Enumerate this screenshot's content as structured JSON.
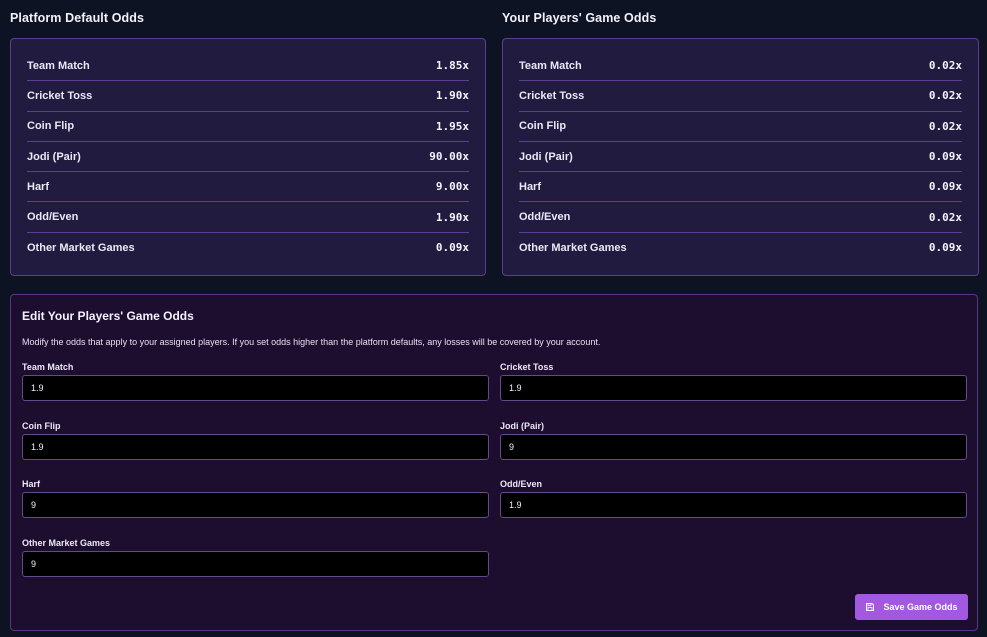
{
  "platform_default": {
    "title": "Platform Default Odds",
    "rows": [
      {
        "label": "Team Match",
        "value": "1.85x"
      },
      {
        "label": "Cricket Toss",
        "value": "1.90x"
      },
      {
        "label": "Coin Flip",
        "value": "1.95x"
      },
      {
        "label": "Jodi (Pair)",
        "value": "90.00x"
      },
      {
        "label": "Harf",
        "value": "9.00x"
      },
      {
        "label": "Odd/Even",
        "value": "1.90x"
      },
      {
        "label": "Other Market Games",
        "value": "0.09x"
      }
    ]
  },
  "players_odds": {
    "title": "Your Players' Game Odds",
    "rows": [
      {
        "label": "Team Match",
        "value": "0.02x"
      },
      {
        "label": "Cricket Toss",
        "value": "0.02x"
      },
      {
        "label": "Coin Flip",
        "value": "0.02x"
      },
      {
        "label": "Jodi (Pair)",
        "value": "0.09x"
      },
      {
        "label": "Harf",
        "value": "0.09x"
      },
      {
        "label": "Odd/Even",
        "value": "0.02x"
      },
      {
        "label": "Other Market Games",
        "value": "0.09x"
      }
    ]
  },
  "edit_form": {
    "title": "Edit Your Players' Game Odds",
    "description": "Modify the odds that apply to your assigned players. If you set odds higher than the platform defaults, any losses will be covered by your account.",
    "fields": [
      {
        "label": "Team Match",
        "value": "1.9"
      },
      {
        "label": "Cricket Toss",
        "value": "1.9"
      },
      {
        "label": "Coin Flip",
        "value": "1.9"
      },
      {
        "label": "Jodi (Pair)",
        "value": "9"
      },
      {
        "label": "Harf",
        "value": "9"
      },
      {
        "label": "Odd/Even",
        "value": "1.9"
      },
      {
        "label": "Other Market Games",
        "value": "9"
      }
    ],
    "save_label": "Save Game Odds",
    "save_icon": "save-icon"
  },
  "colors": {
    "background": "#0d1322",
    "card_background": "#211b40",
    "card_border": "#5a3f8e",
    "edit_background": "#1d0e30",
    "accent": "#a259e0"
  }
}
